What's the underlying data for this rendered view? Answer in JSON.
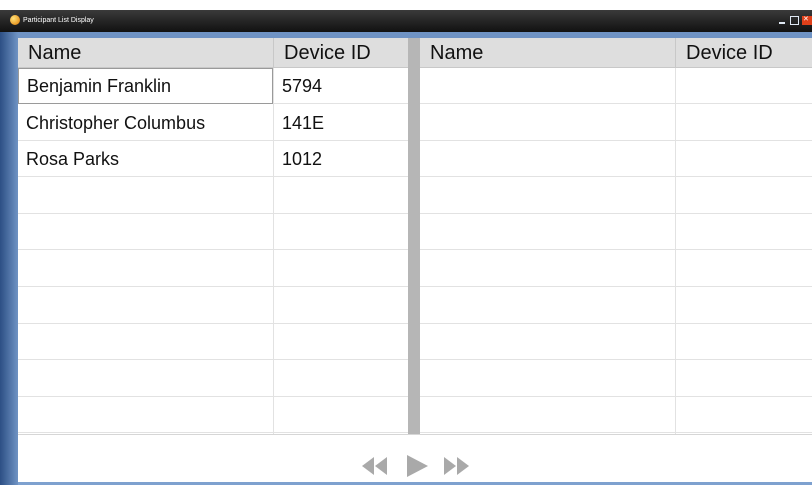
{
  "window": {
    "title": "Participant List Display"
  },
  "left_table": {
    "columns": [
      "Name",
      "Device ID"
    ],
    "rows": [
      [
        "Benjamin Franklin",
        "5794"
      ],
      [
        "Christopher Columbus",
        "141E"
      ],
      [
        "Rosa Parks",
        "1012"
      ],
      [
        "",
        ""
      ],
      [
        "",
        ""
      ],
      [
        "",
        ""
      ],
      [
        "",
        ""
      ],
      [
        "",
        ""
      ],
      [
        "",
        ""
      ],
      [
        "",
        ""
      ]
    ]
  },
  "right_table": {
    "columns": [
      "Name",
      "Device ID"
    ],
    "rows": [
      [
        "",
        ""
      ],
      [
        "",
        ""
      ],
      [
        "",
        ""
      ],
      [
        "",
        ""
      ],
      [
        "",
        ""
      ],
      [
        "",
        ""
      ],
      [
        "",
        ""
      ],
      [
        "",
        ""
      ],
      [
        "",
        ""
      ],
      [
        "",
        ""
      ]
    ]
  },
  "navigation": {
    "icons": [
      "rewind-icon",
      "play-icon",
      "fast-forward-icon"
    ],
    "icon_color": "#a9a9a9"
  },
  "colors": {
    "titlebar": "#1a1a1a",
    "frame": "#4f78b0",
    "header_bg": "#dedede",
    "splitter": "#b6b6b6"
  }
}
